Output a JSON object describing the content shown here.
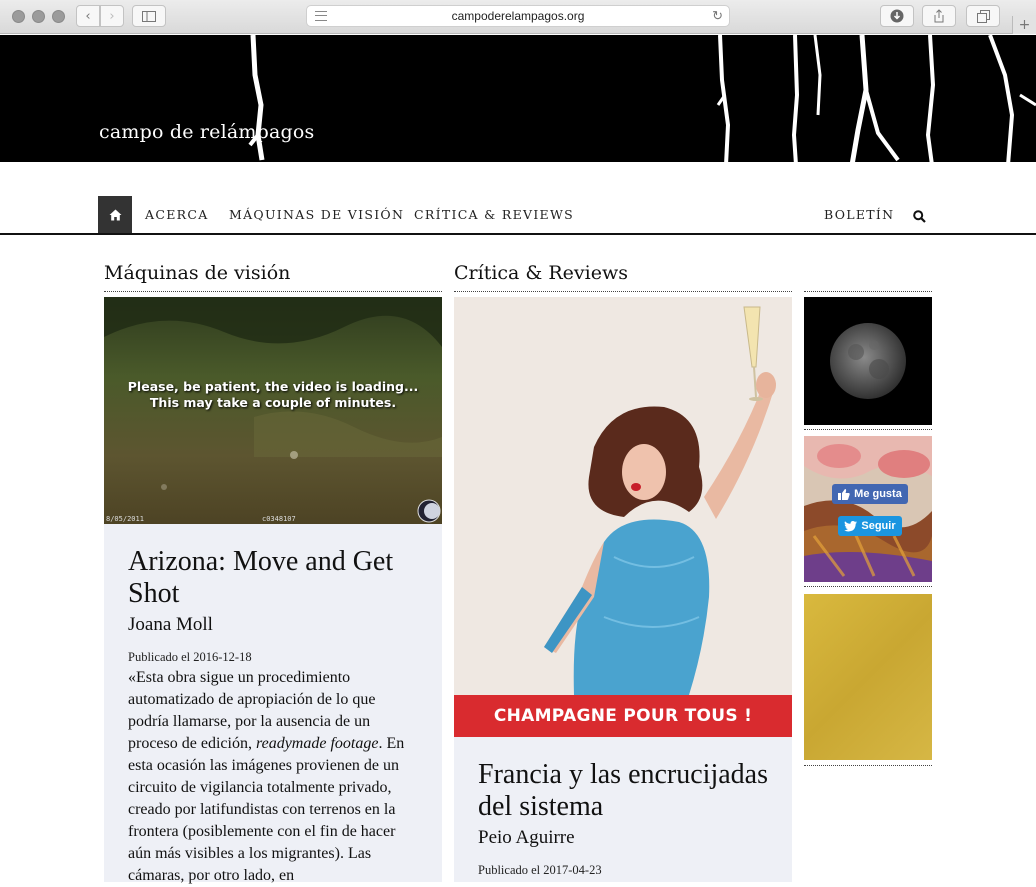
{
  "browser": {
    "url": "campoderelampagos.org",
    "new_tab_label": "+"
  },
  "site": {
    "title": "campo de relámpagos"
  },
  "nav": {
    "items": [
      "ACERCA",
      "MÁQUINAS DE VISIÓN",
      "CRÍTICA & REVIEWS"
    ],
    "right_item": "BOLETÍN"
  },
  "columns": {
    "left": {
      "heading": "Máquinas de visión",
      "video_message_line1": "Please, be patient, the video is loading...",
      "video_message_line2": "This may take a couple of minutes.",
      "video_stamp_left": "8/05/2011",
      "video_stamp_mid": "c0348107",
      "article": {
        "title": "Arizona: Move and Get Shot",
        "author": "Joana Moll",
        "published": "Publicado el 2016-12-18",
        "excerpt_before": "«Esta obra sigue un procedimiento automatizado de apropiación de lo que podría llamarse, por la ausencia de un proceso de edición, ",
        "excerpt_italic": "readymade footage",
        "excerpt_after": ". En esta ocasión las imágenes provienen de un circuito de vigilancia totalmente privado, creado por latifundistas con terrenos en la frontera (posiblemente con el fin de hacer aún más visibles a los migrantes). Las cámaras, por otro lado, en"
      }
    },
    "middle": {
      "heading": "Crítica & Reviews",
      "image_banner": "CHAMPAGNE POUR TOUS !",
      "article": {
        "title": "Francia y las encrucijadas del sistema",
        "author": "Peio Aguirre",
        "published": "Publicado el 2017-04-23"
      }
    },
    "right": {
      "facebook_label": "Me gusta",
      "twitter_label": "Seguir"
    }
  },
  "colors": {
    "banner_bg": "#000000",
    "card_bg": "#eef0f6",
    "champagne_red": "#d92b2f",
    "facebook_blue": "#4267b2",
    "twitter_blue": "#1b95e0",
    "home_button_bg": "#333333"
  },
  "icons": [
    "back-icon",
    "forward-icon",
    "sidebar-icon",
    "reader-icon",
    "reload-icon",
    "download-icon",
    "share-icon",
    "tabs-icon",
    "home-icon",
    "search-icon",
    "facebook-like-icon",
    "twitter-bird-icon"
  ]
}
